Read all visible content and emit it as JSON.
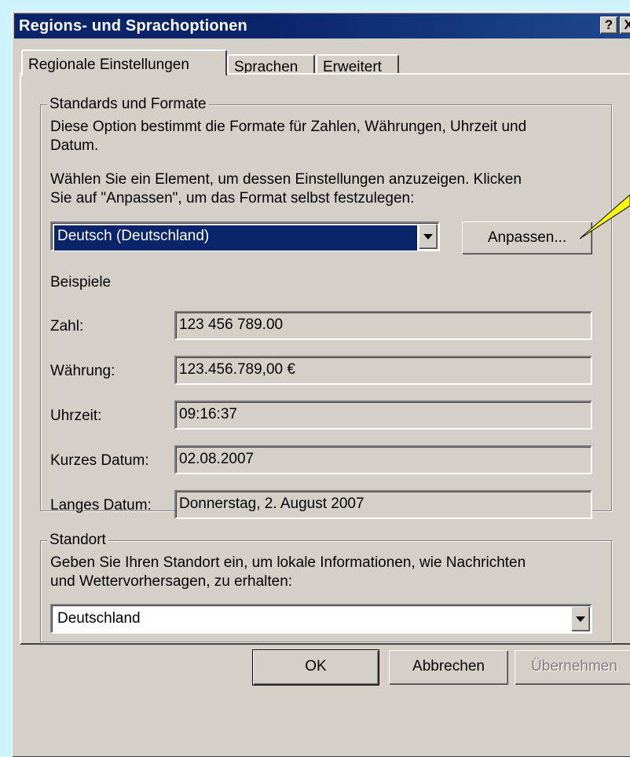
{
  "window": {
    "title": "Regions- und Sprachoptionen",
    "help_button": "?",
    "close_button": "X"
  },
  "tabs": [
    {
      "label": "Regionale Einstellungen",
      "active": true
    },
    {
      "label": "Sprachen",
      "active": false
    },
    {
      "label": "Erweitert",
      "active": false
    }
  ],
  "standards": {
    "group_label": "Standards und Formate",
    "description_line1": "Diese Option bestimmt die Formate für Zahlen, Währungen, Uhrzeit und",
    "description_line2": "Datum.",
    "instruction_line1": "Wählen Sie ein Element, um dessen Einstellungen anzuzeigen. Klicken",
    "instruction_line2": "Sie auf \"Anpassen\", um das Format selbst festzulegen:",
    "format_select": "Deutsch (Deutschland)",
    "customize_button": "Anpassen...",
    "examples_heading": "Beispiele",
    "examples": [
      {
        "label": "Zahl:",
        "value": "123 456 789.00"
      },
      {
        "label": "Währung:",
        "value": "123.456.789,00 €"
      },
      {
        "label": "Uhrzeit:",
        "value": "09:16:37"
      },
      {
        "label": "Kurzes Datum:",
        "value": "02.08.2007"
      },
      {
        "label": "Langes Datum:",
        "value": "Donnerstag, 2. August 2007"
      }
    ]
  },
  "location": {
    "group_label": "Standort",
    "description_line1": "Geben Sie Ihren Standort ein, um lokale Informationen, wie Nachrichten",
    "description_line2": "und Wettervorhersagen, zu erhalten:",
    "location_select": "Deutschland"
  },
  "buttons": {
    "ok": "OK",
    "cancel": "Abbrechen",
    "apply": "Übernehmen"
  },
  "colors": {
    "title_bar": "#0a246a",
    "dialog_face": "#d4d0c8",
    "background": "#cdf3fb",
    "callout": "#ffff00"
  }
}
